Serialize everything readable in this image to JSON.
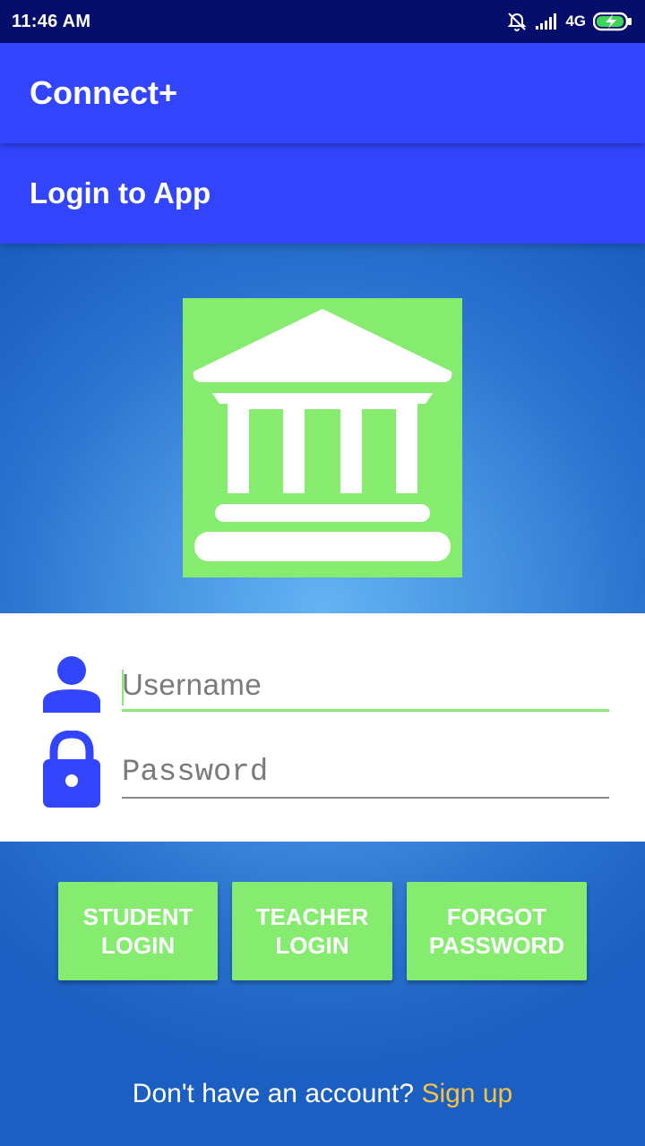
{
  "status_bar": {
    "time": "11:46 AM",
    "network": "4G",
    "icons": [
      "alarm-off-icon",
      "signal-icon",
      "battery-charging-icon"
    ]
  },
  "app_bar": {
    "title": "Connect+"
  },
  "sub_bar": {
    "title": "Login to App"
  },
  "logo": {
    "icon": "bank-building-icon",
    "background": "#86ec70"
  },
  "form": {
    "username": {
      "placeholder": "Username",
      "value": "",
      "icon": "person-icon"
    },
    "password": {
      "placeholder": "Password",
      "value": "",
      "icon": "lock-icon"
    }
  },
  "buttons": {
    "student_login": "STUDENT\nLOGIN",
    "teacher_login": "TEACHER\nLOGIN",
    "forgot_password": "FORGOT\nPASSWORD"
  },
  "footer": {
    "prompt": "Don't have an account?",
    "link": "Sign up"
  },
  "colors": {
    "primary": "#3245fc",
    "status_bar": "#050e6b",
    "accent_green": "#86ec70",
    "link": "#f7c244"
  }
}
